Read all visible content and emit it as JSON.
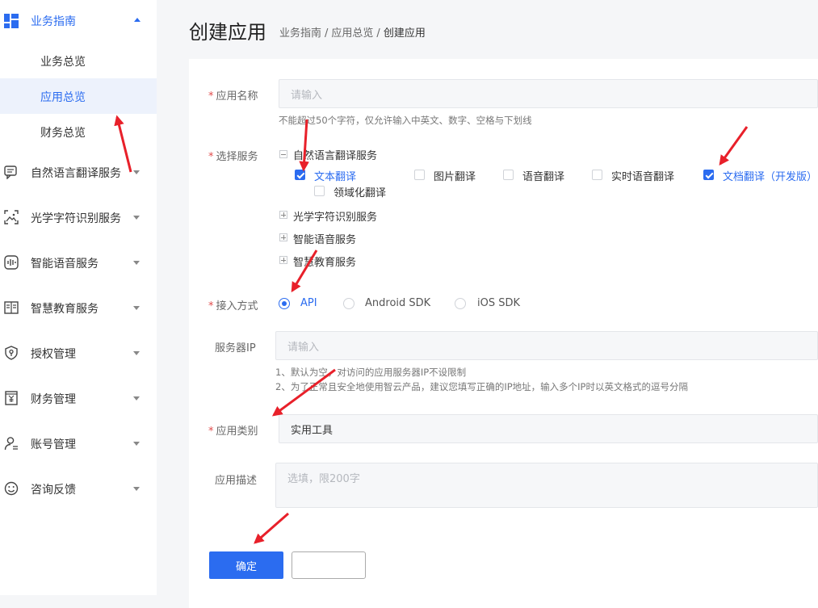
{
  "sidebar": {
    "top": {
      "label": "业务指南",
      "icon": "grid-icon"
    },
    "subitems": [
      {
        "label": "业务总览"
      },
      {
        "label": "应用总览"
      },
      {
        "label": "财务总览"
      }
    ],
    "items": [
      {
        "label": "自然语言翻译服务",
        "icon": "chat-icon"
      },
      {
        "label": "光学字符识别服务",
        "icon": "image-scan-icon"
      },
      {
        "label": "智能语音服务",
        "icon": "voice-icon"
      },
      {
        "label": "智慧教育服务",
        "icon": "book-icon"
      },
      {
        "label": "授权管理",
        "icon": "key-shield-icon"
      },
      {
        "label": "财务管理",
        "icon": "yuan-icon"
      },
      {
        "label": "账号管理",
        "icon": "user-icon"
      },
      {
        "label": "咨询反馈",
        "icon": "smile-icon"
      }
    ]
  },
  "header": {
    "title": "创建应用",
    "breadcrumb": [
      "业务指南",
      "应用总览",
      "创建应用"
    ],
    "separator": "/"
  },
  "form": {
    "app_name": {
      "label": "应用名称",
      "placeholder": "请输入",
      "hint": "不能超过50个字符，仅允许输入中英文、数字、空格与下划线"
    },
    "service": {
      "label": "选择服务",
      "groups": [
        {
          "label": "自然语言翻译服务",
          "expanded": true,
          "options": [
            {
              "label": "文本翻译",
              "checked": true
            },
            {
              "label": "图片翻译",
              "checked": false
            },
            {
              "label": "语音翻译",
              "checked": false
            },
            {
              "label": "实时语音翻译",
              "checked": false
            },
            {
              "label": "文档翻译（开发版）",
              "checked": true
            },
            {
              "label": "领域化翻译",
              "checked": false
            }
          ]
        },
        {
          "label": "光学字符识别服务",
          "expanded": false
        },
        {
          "label": "智能语音服务",
          "expanded": false
        },
        {
          "label": "智慧教育服务",
          "expanded": false
        }
      ]
    },
    "access": {
      "label": "接入方式",
      "options": [
        {
          "label": "API",
          "selected": true
        },
        {
          "label": "Android SDK",
          "selected": false
        },
        {
          "label": "iOS SDK",
          "selected": false
        }
      ]
    },
    "server_ip": {
      "label": "服务器IP",
      "placeholder": "请输入",
      "hints": [
        "1、默认为空，对访问的应用服务器IP不设限制",
        "2、为了正常且安全地使用智云产品，建议您填写正确的IP地址，输入多个IP时以英文格式的逗号分隔"
      ]
    },
    "category": {
      "label": "应用类别",
      "value": "实用工具"
    },
    "description": {
      "label": "应用描述",
      "placeholder": "选填，限200字"
    },
    "required_mark": "*",
    "confirm_label": "确定",
    "cancel_label": ""
  },
  "colors": {
    "accent": "#2b6cf0",
    "annotation_arrow": "#e8202a"
  }
}
